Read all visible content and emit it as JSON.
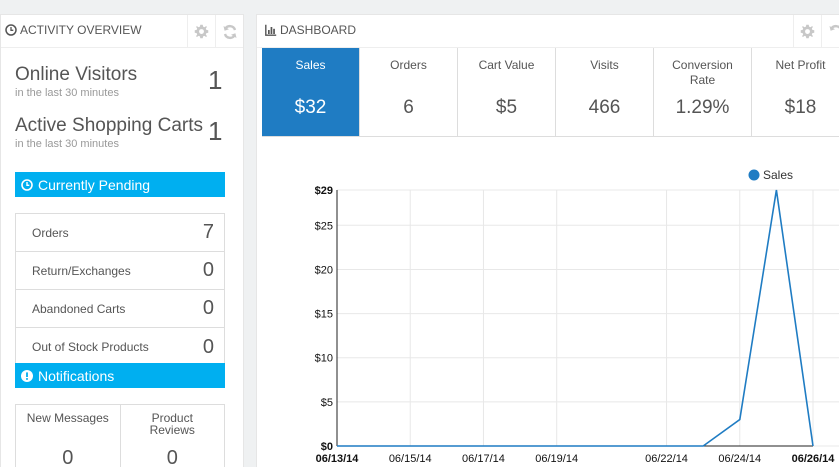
{
  "activity": {
    "title": "ACTIVITY OVERVIEW",
    "online_visitors": {
      "label": "Online Visitors",
      "sub": "in the last 30 minutes",
      "value": "1"
    },
    "active_carts": {
      "label": "Active Shopping Carts",
      "sub": "in the last 30 minutes",
      "value": "1"
    },
    "pending": {
      "title": "Currently Pending",
      "items": [
        {
          "label": "Orders",
          "value": "7"
        },
        {
          "label": "Return/Exchanges",
          "value": "0"
        },
        {
          "label": "Abandoned Carts",
          "value": "0"
        },
        {
          "label": "Out of Stock Products",
          "value": "0"
        }
      ]
    },
    "notifications": {
      "title": "Notifications",
      "new_messages": {
        "label": "New Messages",
        "value": "0"
      },
      "product_reviews": {
        "label": "Product Reviews",
        "value": "0"
      }
    }
  },
  "dashboard": {
    "title": "DASHBOARD",
    "kpis": [
      {
        "label": "Sales",
        "value": "$32",
        "active": true
      },
      {
        "label": "Orders",
        "value": "6"
      },
      {
        "label": "Cart Value",
        "value": "$5"
      },
      {
        "label": "Visits",
        "value": "466"
      },
      {
        "label": "Conversion Rate",
        "value": "1.29%"
      },
      {
        "label": "Net Profit",
        "value": "$18"
      }
    ]
  },
  "icons": {
    "header_gear": "gear-icon",
    "header_refresh": "refresh-icon",
    "activity_title": "clock-icon",
    "dashboard_title": "bar-chart-icon",
    "pending": "clock-icon",
    "notifications": "exclamation-icon"
  },
  "colors": {
    "accent": "#00aff0",
    "active_kpi": "#1f7cc3",
    "series": "#1f7cc3"
  },
  "chart_data": {
    "type": "line",
    "legend": "top-right",
    "series": [
      {
        "name": "Sales",
        "x": [
          "2014-06-13",
          "2014-06-14",
          "2014-06-15",
          "2014-06-16",
          "2014-06-17",
          "2014-06-18",
          "2014-06-19",
          "2014-06-20",
          "2014-06-21",
          "2014-06-22",
          "2014-06-23",
          "2014-06-24",
          "2014-06-25",
          "2014-06-26"
        ],
        "values": [
          0,
          0,
          0,
          0,
          0,
          0,
          0,
          0,
          0,
          0,
          0,
          3,
          29,
          0
        ]
      }
    ],
    "x_ticks": [
      "06/13/14",
      "06/15/14",
      "06/17/14",
      "06/19/14",
      "06/22/14",
      "06/24/14",
      "06/26/14"
    ],
    "y_ticks": [
      "$0",
      "$5",
      "$10",
      "$15",
      "$20",
      "$25",
      "$29"
    ],
    "ylim": [
      0,
      29
    ],
    "grid": true
  }
}
